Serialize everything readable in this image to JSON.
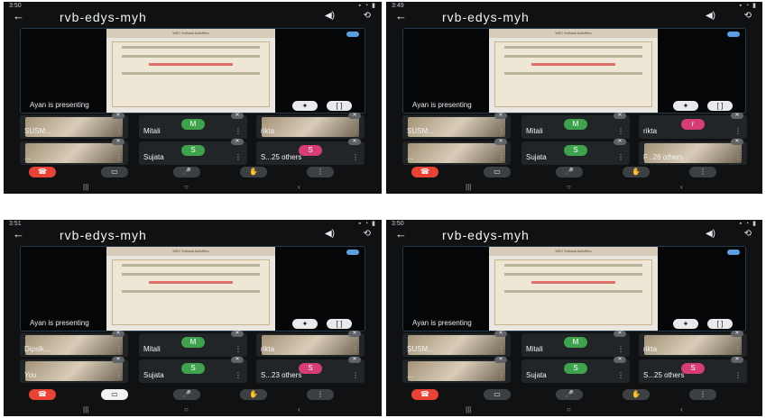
{
  "call_title": "rvb-edys-myh",
  "presenting_text": "Ayan is presenting",
  "slide": {
    "header": "MEC Kolkata Activities",
    "body_title": "Celebrating India's presidency of the G20"
  },
  "colors": {
    "panel_bg": "#0f1113",
    "end_button": "#ea4335",
    "avatar_green": "#3fa34d",
    "avatar_pink": "#d63d74",
    "accent_blue": "#5aa0e0"
  },
  "icons": {
    "back": "arrow-left-icon",
    "speaker": "speaker-icon",
    "switch_camera": "camera-switch-icon",
    "end_call": "end-call-icon",
    "video": "video-icon",
    "mic": "mic-icon",
    "hand": "raise-hand-icon",
    "more": "more-icon"
  },
  "panels": [
    {
      "time": "3:50",
      "tiles": [
        {
          "name": "SUSM...",
          "avatar": "",
          "kind": "photo"
        },
        {
          "name": "Mitali",
          "avatar": "M",
          "avatar_color": "green"
        },
        {
          "name": "rikta",
          "avatar": "",
          "kind": "photo"
        },
        {
          "name": "...",
          "avatar": "",
          "kind": "photo"
        },
        {
          "name": "Sujata",
          "avatar": "S",
          "avatar_color": "green"
        },
        {
          "name": "S...25 others",
          "avatar": "S",
          "avatar_color": "pink"
        }
      ]
    },
    {
      "time": "3:49",
      "tiles": [
        {
          "name": "SUSM...",
          "avatar": "",
          "kind": "photo"
        },
        {
          "name": "Mitali",
          "avatar": "M",
          "avatar_color": "green"
        },
        {
          "name": "rikta",
          "avatar": "r",
          "avatar_color": "pink"
        },
        {
          "name": "...",
          "avatar": "",
          "kind": "photo"
        },
        {
          "name": "Sujata",
          "avatar": "S",
          "avatar_color": "green"
        },
        {
          "name": "F...26 others",
          "avatar": "",
          "kind": "photo"
        }
      ]
    },
    {
      "time": "3:51",
      "tiles": [
        {
          "name": "Dipsik...",
          "avatar": "",
          "kind": "photo"
        },
        {
          "name": "Mitali",
          "avatar": "M",
          "avatar_color": "green"
        },
        {
          "name": "rikta",
          "avatar": "",
          "kind": "photo"
        },
        {
          "name": "You",
          "avatar": "",
          "kind": "photo"
        },
        {
          "name": "Sujata",
          "avatar": "S",
          "avatar_color": "green"
        },
        {
          "name": "S...23 others",
          "avatar": "S",
          "avatar_color": "pink"
        }
      ]
    },
    {
      "time": "3:50",
      "tiles": [
        {
          "name": "SUSM...",
          "avatar": "",
          "kind": "photo"
        },
        {
          "name": "Mitali",
          "avatar": "M",
          "avatar_color": "green"
        },
        {
          "name": "rikta",
          "avatar": "",
          "kind": "photo"
        },
        {
          "name": "...",
          "avatar": "",
          "kind": "photo"
        },
        {
          "name": "Sujata",
          "avatar": "S",
          "avatar_color": "green"
        },
        {
          "name": "S...25 others",
          "avatar": "S",
          "avatar_color": "pink"
        }
      ]
    }
  ]
}
